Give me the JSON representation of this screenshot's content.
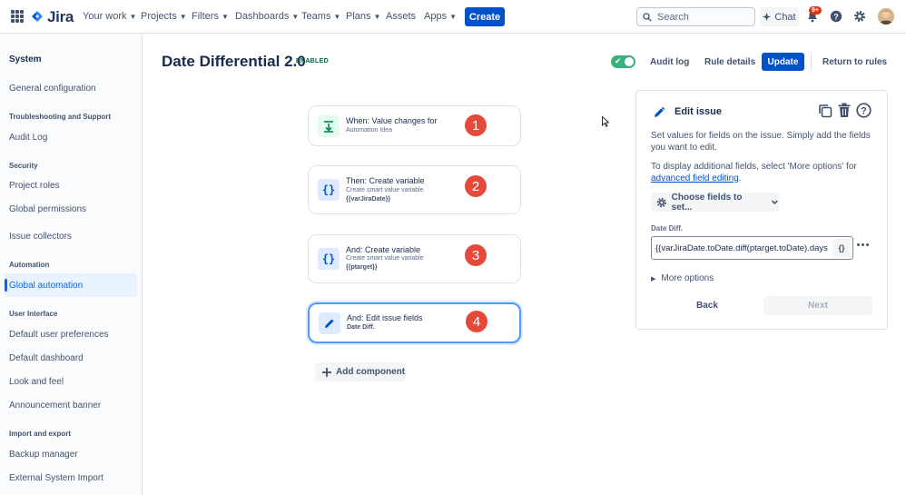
{
  "topnav": {
    "logo_text": "Jira",
    "items": [
      {
        "label": "Your work",
        "dropdown": true
      },
      {
        "label": "Projects",
        "dropdown": true
      },
      {
        "label": "Filters",
        "dropdown": true
      },
      {
        "label": "Dashboards",
        "dropdown": true
      },
      {
        "label": "Teams",
        "dropdown": true
      },
      {
        "label": "Plans",
        "dropdown": true
      },
      {
        "label": "Assets",
        "dropdown": false
      },
      {
        "label": "Apps",
        "dropdown": true
      }
    ],
    "create_label": "Create",
    "search_placeholder": "Search",
    "chat_label": "Chat",
    "notifications_badge": "9+",
    "icons": [
      "apps-grid-icon",
      "search-icon",
      "chat-icon",
      "bell-icon",
      "help-icon",
      "gear-icon"
    ]
  },
  "sidebar": {
    "title": "System",
    "sections": [
      {
        "heading": "",
        "items": [
          "General configuration"
        ]
      },
      {
        "heading": "Troubleshooting and Support",
        "items": [
          "Audit Log"
        ]
      },
      {
        "heading": "Security",
        "items": [
          "Project roles",
          "Global permissions",
          "Issue collectors"
        ]
      },
      {
        "heading": "Automation",
        "items": [
          "Global automation"
        ]
      },
      {
        "heading": "User Interface",
        "items": [
          "Default user preferences",
          "Default dashboard",
          "Look and feel",
          "Announcement banner"
        ]
      },
      {
        "heading": "Import and export",
        "items": [
          "Backup manager",
          "External System Import"
        ]
      }
    ],
    "active_item": "Global automation"
  },
  "header": {
    "title": "Date Differential 2.0",
    "status": "ENABLED",
    "toggle_on": true,
    "audit_log": "Audit log",
    "rule_details": "Rule details",
    "update": "Update",
    "return": "Return to rules"
  },
  "rule": {
    "components": [
      {
        "title": "When: Value changes for",
        "sub1": "Automation Idea",
        "sub2": "",
        "number": "1",
        "icon": "trigger-icon"
      },
      {
        "title": "Then: Create variable",
        "sub1": "Create smart value variable",
        "sub2": "{{varJiraDate}}",
        "number": "2",
        "icon": "smart-value-icon"
      },
      {
        "title": "And: Create variable",
        "sub1": "Create smart value variable",
        "sub2": "{{ptarget}}",
        "number": "3",
        "icon": "smart-value-icon"
      },
      {
        "title": "And: Edit issue fields",
        "sub1": "Date Diff.",
        "sub2": "",
        "number": "4",
        "icon": "pencil-icon"
      }
    ],
    "add_component": "Add component"
  },
  "panel": {
    "title": "Edit issue",
    "desc1": "Set values for fields on the issue. Simply add the fields you want to edit.",
    "desc2_prefix": "To display additional fields, select 'More options' for ",
    "desc2_link": "advanced field editing",
    "desc2_suffix": ".",
    "choose_fields": "Choose fields to set...",
    "field_label": "Date Diff.",
    "field_value": "{{varJiraDate.toDate.diff(ptarget.toDate).days",
    "more_options": "More options",
    "back": "Back",
    "next": "Next"
  },
  "colors": {
    "primary": "#0052cc",
    "enabled": "#36b37e",
    "badge_red": "#e5493a",
    "selected_border": "#4c9aff"
  }
}
